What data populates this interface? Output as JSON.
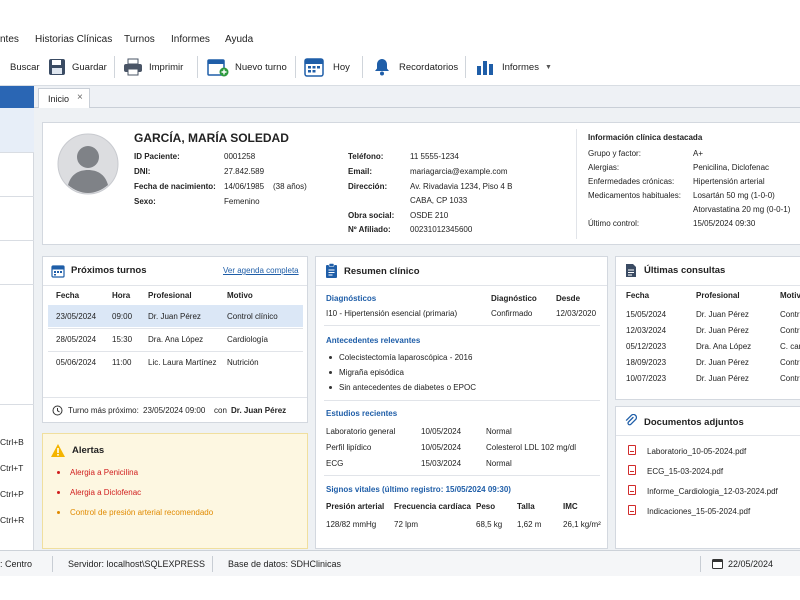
{
  "menu": [
    "ntes",
    "Historias Clínicas",
    "Turnos",
    "Informes",
    "Ayuda"
  ],
  "toolbar": {
    "search_label": "Buscar",
    "save_label": "Guardar",
    "print_label": "Imprimir",
    "new_turn_label": "Nuevo turno",
    "today_label": "Hoy",
    "reminders_label": "Recordatorios",
    "reports_label": "Informes"
  },
  "sidebar_shortcuts": [
    "Ctrl+B",
    "Ctrl+T",
    "Ctrl+P",
    "Ctrl+R"
  ],
  "tab": {
    "label": "Inicio",
    "close": "×"
  },
  "patient": {
    "name": "GARCÍA, MARÍA SOLEDAD",
    "id_label": "ID Paciente:",
    "id": "0001258",
    "dni_label": "DNI:",
    "dni": "27.842.589",
    "birth_label": "Fecha de nacimiento:",
    "birth": "14/06/1985",
    "age": "(38 años)",
    "sex_label": "Sexo:",
    "sex": "Femenino",
    "phone_label": "Teléfono:",
    "phone": "11 5555-1234",
    "email_label": "Email:",
    "email": "mariagarcia@example.com",
    "address_label": "Dirección:",
    "address_1": "Av. Rivadavia 1234, Piso 4 B",
    "address_2": "CABA, CP 1033",
    "insurance_label": "Obra social:",
    "insurance": "OSDE 210",
    "member_label": "Nº Afiliado:",
    "member": "00231012345600"
  },
  "clinical_info": {
    "title": "Información clínica destacada",
    "blood_label": "Grupo y factor:",
    "blood": "A+",
    "allergies_label": "Alergias:",
    "allergies": "Penicilina, Diclofenac",
    "chronic_label": "Enfermedades crónicas:",
    "chronic": "Hipertensión arterial",
    "meds_label": "Medicamentos habituales:",
    "med_1": "Losartán 50 mg (1-0-0)",
    "med_2": "Atorvastatina 20 mg (0-0-1)",
    "last_label": "Último control:",
    "last": "15/05/2024  09:30"
  },
  "upcoming": {
    "title": "Próximos turnos",
    "link": "Ver agenda completa",
    "headers": [
      "Fecha",
      "Hora",
      "Profesional",
      "Motivo"
    ],
    "rows": [
      [
        "23/05/2024",
        "09:00",
        "Dr. Juan Pérez",
        "Control clínico"
      ],
      [
        "28/05/2024",
        "15:30",
        "Dra. Ana López",
        "Cardiología"
      ],
      [
        "05/06/2024",
        "11:00",
        "Lic. Laura Martínez",
        "Nutrición"
      ]
    ],
    "next_label": "Turno más próximo:",
    "next_value": "23/05/2024  09:00",
    "next_with": "con",
    "next_doctor": "Dr. Juan Pérez"
  },
  "alerts": {
    "title": "Alertas",
    "items": [
      "Alergia a Penicilina",
      "Alergia a Diclofenac",
      "Control de presión arterial recomendado"
    ]
  },
  "summary": {
    "title": "Resumen clínico",
    "diag_title": "Diagnósticos",
    "diag_col": "Diagnóstico",
    "since_col": "Desde",
    "diag_row": [
      "I10 - Hipertensión esencial (primaria)",
      "Confirmado",
      "12/03/2020"
    ],
    "history_title": "Antecedentes relevantes",
    "history": [
      "Colecistectomía laparoscópica - 2016",
      "Migraña episódica",
      "Sin antecedentes de diabetes o EPOC"
    ],
    "studies_title": "Estudios recientes",
    "studies": [
      [
        "Laboratorio general",
        "10/05/2024",
        "Normal"
      ],
      [
        "Perfil lipídico",
        "10/05/2024",
        "Colesterol LDL 102 mg/dl"
      ],
      [
        "ECG",
        "15/03/2024",
        "Normal"
      ]
    ],
    "vitals_title": "Signos vitales (último registro: 15/05/2024 09:30)",
    "vitals_headers": [
      "Presión arterial",
      "Frecuencia cardíaca",
      "Peso",
      "Talla",
      "IMC"
    ],
    "vitals": [
      "128/82 mmHg",
      "72 lpm",
      "68,5 kg",
      "1,62 m",
      "26,1 kg/m²"
    ]
  },
  "consults": {
    "title": "Últimas consultas",
    "headers": [
      "Fecha",
      "Profesional",
      "Motivo"
    ],
    "rows": [
      [
        "15/05/2024",
        "Dr. Juan Pérez",
        "Contro"
      ],
      [
        "12/03/2024",
        "Dr. Juan Pérez",
        "Contro"
      ],
      [
        "05/12/2023",
        "Dra. Ana López",
        "C. card"
      ],
      [
        "18/09/2023",
        "Dr. Juan Pérez",
        "Contro"
      ],
      [
        "10/07/2023",
        "Dr. Juan Pérez",
        "Contro"
      ]
    ]
  },
  "docs": {
    "title": "Documentos adjuntos",
    "files": [
      "Laboratorio_10-05-2024.pdf",
      "ECG_15-03-2024.pdf",
      "Informe_Cardiologia_12-03-2024.pdf",
      "Indicaciones_15-05-2024.pdf"
    ]
  },
  "status": {
    "site": ": Centro",
    "server": "Servidor: localhost\\SQLEXPRESS",
    "db": "Base de datos: SDHClinicas",
    "date": "22/05/2024"
  },
  "colors": {
    "accent": "#2a66b4",
    "alert_red": "#d01e1e",
    "alert_orange": "#e08a00"
  }
}
